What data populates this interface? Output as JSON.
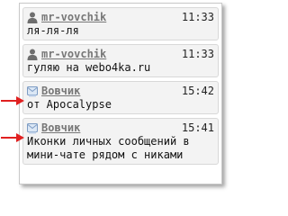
{
  "messages": [
    {
      "author": "mr-vovchik",
      "time": "11:33",
      "text": "ля-ля-ля",
      "icon": "user-icon",
      "highlighted": false
    },
    {
      "author": "mr-vovchik",
      "time": "11:33",
      "text": "гуляю на webo4ka.ru",
      "icon": "user-icon",
      "highlighted": false
    },
    {
      "author": "Вовчик",
      "time": "15:42",
      "text": "от Apocalypse",
      "icon": "private-message-icon",
      "highlighted": true
    },
    {
      "author": "Вовчик",
      "time": "15:41",
      "text": "Иконки личных сообщений в\nмини-чате рядом с никами",
      "icon": "private-message-icon",
      "highlighted": true
    }
  ],
  "colors": {
    "arrow": "#e02020",
    "author": "#777777",
    "message_bg": "#f3f3f3"
  }
}
